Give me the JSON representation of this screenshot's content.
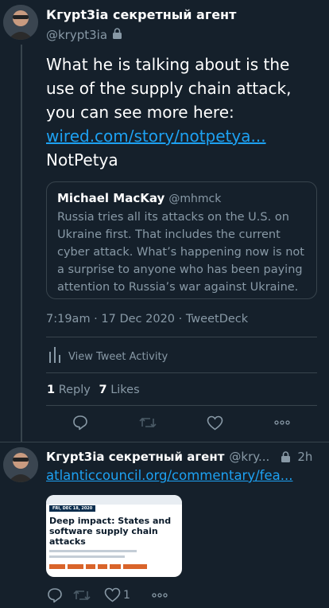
{
  "main_tweet": {
    "author_name": "Кгурt3іа секретный агент",
    "handle": "@krypt3ia",
    "text_plain_1": "What he is talking about is the use of the supply chain attack, you can see more here: ",
    "link_text": "wired.com/story/notpetya...",
    "text_plain_2": "NotPetya",
    "quote": {
      "author_name": "Michael MacKay",
      "handle": "@mhmck",
      "text": "Russia tries all its attacks on the U.S. on Ukraine first. That includes the current cyber attack. What’s happening now is not a surprise to anyone who has been paying attention to Russia’s war against Ukraine."
    },
    "timestamp": "7:19am · 17 Dec 2020 · TweetDeck",
    "activity_label": "View Tweet Activity",
    "stats": {
      "reply_count": "1",
      "reply_label": "Reply",
      "like_count": "7",
      "like_label": "Likes"
    }
  },
  "reply_tweet": {
    "author_name": "Кгурt3іа секретный агент",
    "handle": "@kry...",
    "time": "2h",
    "link_text": "atlanticcouncil.org/commentary/fea...",
    "card": {
      "date": "FRI, DEC 18, 2020",
      "headline": "Deep impact: States and software supply chain attacks"
    },
    "like_count": "1"
  },
  "colors": {
    "background": "#15202b",
    "text_secondary": "#8899a6",
    "link": "#1da1f2",
    "border": "#38444d"
  }
}
